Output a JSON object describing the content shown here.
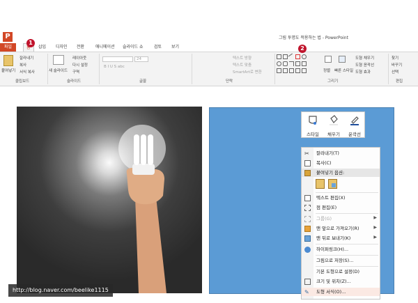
{
  "window": {
    "title": "그림 투명도 적용하는 법 - PowerPoint",
    "app_logo": "P"
  },
  "tabs": [
    {
      "label": "파일",
      "kind": "file"
    },
    {
      "label": "홈",
      "kind": "active"
    },
    {
      "label": "삽입"
    },
    {
      "label": "디자인"
    },
    {
      "label": "전환"
    },
    {
      "label": "애니메이션"
    },
    {
      "label": "슬라이드 쇼"
    },
    {
      "label": "검토"
    },
    {
      "label": "보기"
    }
  ],
  "ribbon": {
    "clipboard": {
      "paste": "붙여넣기",
      "cut": "잘라내기",
      "copy": "복사",
      "format_painter": "서식 복사",
      "label": "클립보드"
    },
    "slides": {
      "new_slide": "새 슬라이드",
      "layout": "레이아웃",
      "reset": "다시 설정",
      "section": "구역",
      "label": "슬라이드"
    },
    "font": {
      "size": "24",
      "label": "글꼴"
    },
    "paragraph": {
      "text_direction": "텍스트 방향",
      "align_text": "텍스트 맞춤",
      "smartart": "SmartArt로 변환",
      "label": "단락"
    },
    "drawing": {
      "arrange": "정렬",
      "quick_styles": "빠른 스타일",
      "fill": "도형 채우기",
      "outline": "도형 윤곽선",
      "effects": "도형 효과",
      "label": "그리기"
    },
    "editing": {
      "find": "찾기",
      "replace": "바꾸기",
      "select": "선택",
      "label": "편집"
    }
  },
  "markers": {
    "one": "1",
    "two": "2"
  },
  "minibar": {
    "style": "스타일",
    "fill": "채우기",
    "outline": "윤곽선"
  },
  "context_menu": {
    "cut": "잘라내기(T)",
    "copy": "복사(C)",
    "paste_options": "붙여넣기 옵션:",
    "edit_text": "텍스트 편집(X)",
    "edit_points": "점 편집(E)",
    "group": "그룹(G)",
    "bring_to_front": "맨 앞으로 가져오기(R)",
    "send_to_back": "맨 뒤로 보내기(K)",
    "hyperlink": "하이퍼링크(H)...",
    "save_as_picture": "그림으로 저장(S)...",
    "set_default_shape": "기본 도형으로 설정(D)",
    "size_position": "크기 및 위치(Z)...",
    "format_shape": "도형 서식(O)..."
  },
  "watermark": "http://blog.naver.com/beelike1115",
  "colors": {
    "accent": "#d24726",
    "shape_fill": "#5b9bd5",
    "marker": "#c0142c"
  }
}
